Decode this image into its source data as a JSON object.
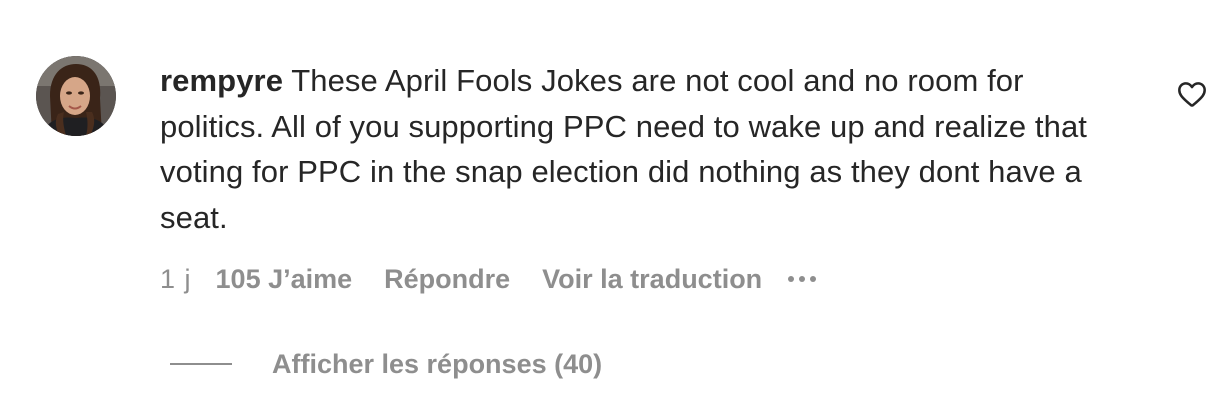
{
  "comment": {
    "username": "rempyre",
    "text": "These April Fools Jokes are not cool and no room for politics. All of you supporting PPC need to wake up and realize that voting for PPC in the snap election did nothing as they dont have a seat.",
    "time": "1 j",
    "likes": "105 J’aime",
    "reply_label": "Répondre",
    "translate_label": "Voir la traduction",
    "more_icon": "ellipsis-icon",
    "like_icon": "heart-outline-icon"
  },
  "replies": {
    "label": "Afficher les réponses (40)"
  },
  "colors": {
    "text": "#262626",
    "secondary": "#8e8e8e",
    "background": "#ffffff"
  }
}
